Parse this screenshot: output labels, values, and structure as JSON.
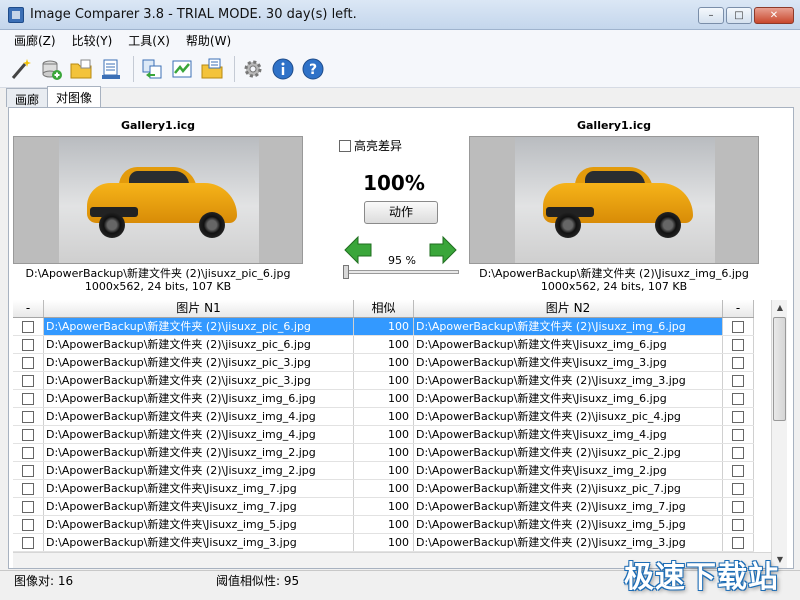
{
  "window": {
    "title": "Image Comparer 3.8 - TRIAL MODE. 30 day(s) left.",
    "minimize": "–",
    "maximize": "□",
    "close": "✕"
  },
  "menu": [
    "画廊(Z)",
    "比较(Y)",
    "工具(X)",
    "帮助(W)"
  ],
  "toolbar": {
    "icons": [
      "wand-icon",
      "add-gallery-icon",
      "open-folder-icon",
      "scan-icon",
      "compare-icon",
      "sync-icon",
      "export-folder-icon",
      "settings-icon",
      "info-icon",
      "help-icon"
    ]
  },
  "tabs": [
    "画廊",
    "对图像"
  ],
  "compare": {
    "left_title": "Gallery1.icg",
    "right_title": "Gallery1.icg",
    "left_path": "D:\\ApowerBackup\\新建文件夹 (2)\\jisuxz_pic_6.jpg",
    "left_info": "1000x562, 24 bits, 107 KB",
    "right_path": "D:\\ApowerBackup\\新建文件夹 (2)\\Jisuxz_img_6.jpg",
    "right_info": "1000x562, 24 bits, 107 KB",
    "highlight_label": "高亮差异",
    "similarity": "100%",
    "action_label": "动作",
    "threshold_text": "95 %",
    "threshold_value": 95
  },
  "grid": {
    "headers": [
      "-",
      "图片 N1",
      "相似",
      "图片 N2",
      "-"
    ],
    "rows": [
      {
        "n1": "D:\\ApowerBackup\\新建文件夹 (2)\\jisuxz_pic_6.jpg",
        "sim": "100",
        "n2": "D:\\ApowerBackup\\新建文件夹 (2)\\Jisuxz_img_6.jpg",
        "selected": true
      },
      {
        "n1": "D:\\ApowerBackup\\新建文件夹 (2)\\jisuxz_pic_6.jpg",
        "sim": "100",
        "n2": "D:\\ApowerBackup\\新建文件夹\\Jisuxz_img_6.jpg"
      },
      {
        "n1": "D:\\ApowerBackup\\新建文件夹 (2)\\jisuxz_pic_3.jpg",
        "sim": "100",
        "n2": "D:\\ApowerBackup\\新建文件夹\\Jisuxz_img_3.jpg"
      },
      {
        "n1": "D:\\ApowerBackup\\新建文件夹 (2)\\jisuxz_pic_3.jpg",
        "sim": "100",
        "n2": "D:\\ApowerBackup\\新建文件夹 (2)\\Jisuxz_img_3.jpg"
      },
      {
        "n1": "D:\\ApowerBackup\\新建文件夹 (2)\\Jisuxz_img_6.jpg",
        "sim": "100",
        "n2": "D:\\ApowerBackup\\新建文件夹\\Jisuxz_img_6.jpg"
      },
      {
        "n1": "D:\\ApowerBackup\\新建文件夹 (2)\\Jisuxz_img_4.jpg",
        "sim": "100",
        "n2": "D:\\ApowerBackup\\新建文件夹 (2)\\jisuxz_pic_4.jpg"
      },
      {
        "n1": "D:\\ApowerBackup\\新建文件夹 (2)\\Jisuxz_img_4.jpg",
        "sim": "100",
        "n2": "D:\\ApowerBackup\\新建文件夹\\Jisuxz_img_4.jpg"
      },
      {
        "n1": "D:\\ApowerBackup\\新建文件夹 (2)\\Jisuxz_img_2.jpg",
        "sim": "100",
        "n2": "D:\\ApowerBackup\\新建文件夹 (2)\\jisuxz_pic_2.jpg"
      },
      {
        "n1": "D:\\ApowerBackup\\新建文件夹 (2)\\Jisuxz_img_2.jpg",
        "sim": "100",
        "n2": "D:\\ApowerBackup\\新建文件夹\\Jisuxz_img_2.jpg"
      },
      {
        "n1": "D:\\ApowerBackup\\新建文件夹\\Jisuxz_img_7.jpg",
        "sim": "100",
        "n2": "D:\\ApowerBackup\\新建文件夹 (2)\\jisuxz_pic_7.jpg"
      },
      {
        "n1": "D:\\ApowerBackup\\新建文件夹\\Jisuxz_img_7.jpg",
        "sim": "100",
        "n2": "D:\\ApowerBackup\\新建文件夹 (2)\\Jisuxz_img_7.jpg"
      },
      {
        "n1": "D:\\ApowerBackup\\新建文件夹\\Jisuxz_img_5.jpg",
        "sim": "100",
        "n2": "D:\\ApowerBackup\\新建文件夹 (2)\\Jisuxz_img_5.jpg"
      },
      {
        "n1": "D:\\ApowerBackup\\新建文件夹\\Jisuxz_img_3.jpg",
        "sim": "100",
        "n2": "D:\\ApowerBackup\\新建文件夹 (2)\\Jisuxz_img_3.jpg"
      }
    ]
  },
  "status": {
    "pairs": "图像对: 16",
    "threshold": "阈值相似性: 95"
  },
  "watermark": "极速下载站",
  "colors": {
    "selection": "#3399ff",
    "arrow_green": "#3aa63a",
    "car_yellow": "#f2a90e"
  }
}
